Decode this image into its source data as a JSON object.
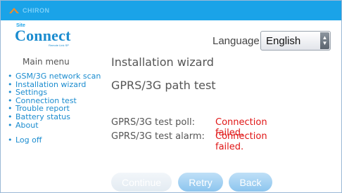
{
  "header": {
    "brand": "CHIRON"
  },
  "logo": {
    "small": "Site",
    "main": "Connect",
    "tag": "Remote Link SP"
  },
  "language": {
    "label": "Language:",
    "selected": "English"
  },
  "sidebar": {
    "title": "Main menu",
    "items": [
      {
        "label": "GSM/3G network scan"
      },
      {
        "label": "Installation wizard"
      },
      {
        "label": "Settings"
      },
      {
        "label": "Connection test"
      },
      {
        "label": "Trouble report"
      },
      {
        "label": "Battery status"
      },
      {
        "label": "About"
      },
      {
        "label": "Log off"
      }
    ]
  },
  "main": {
    "page_title": "Installation wizard",
    "section_title": "GPRS/3G path test",
    "results": [
      {
        "label": "GPRS/3G test poll:",
        "status": "Connection failed."
      },
      {
        "label": "GPRS/3G test alarm:",
        "status": "Connection failed."
      }
    ]
  },
  "buttons": {
    "continue": "Continue",
    "retry": "Retry",
    "back": "Back"
  },
  "colors": {
    "topbar": "#1aa3e8",
    "link": "#1b8ccf",
    "error": "#e01515"
  }
}
